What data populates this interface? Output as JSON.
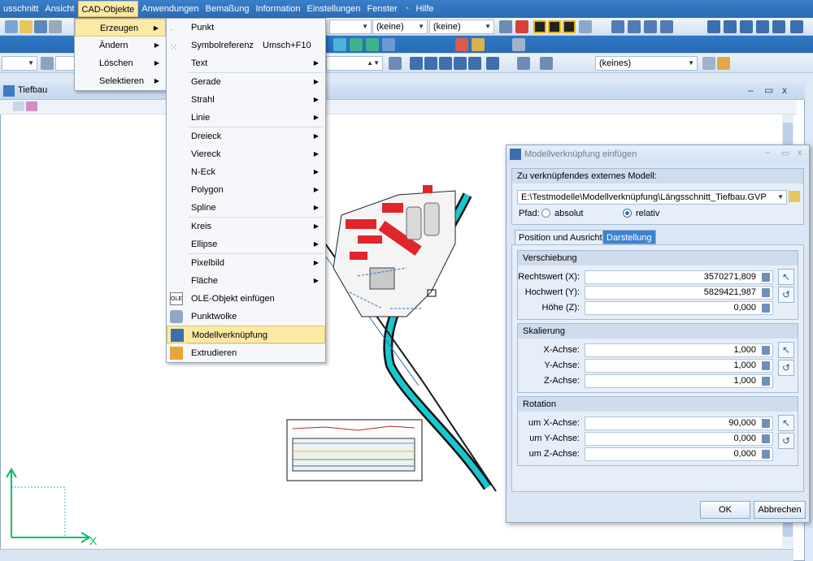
{
  "menubar": {
    "items": [
      "usschnitt",
      "Ansicht",
      "CAD-Objekte",
      "Anwendungen",
      "Bemaßung",
      "Information",
      "Einstellungen",
      "Fenster",
      "Hilfe"
    ]
  },
  "toolbar": {
    "combo1": "(keine)",
    "combo2": "(keine)",
    "combo3": "(keines)"
  },
  "cad_menu": {
    "items": [
      "Erzeugen",
      "Ändern",
      "Löschen",
      "Selektieren"
    ]
  },
  "erzeugen_menu": {
    "items": [
      {
        "label": "Punkt",
        "shortcut": "",
        "submenu": false
      },
      {
        "label": "Symbolreferenz",
        "shortcut": "Umsch+F10",
        "submenu": false
      },
      {
        "label": "Text",
        "shortcut": "",
        "submenu": true
      },
      {
        "label": "Gerade",
        "shortcut": "",
        "submenu": true
      },
      {
        "label": "Strahl",
        "shortcut": "",
        "submenu": true
      },
      {
        "label": "Linie",
        "shortcut": "",
        "submenu": true
      },
      {
        "label": "Dreieck",
        "shortcut": "",
        "submenu": true
      },
      {
        "label": "Viereck",
        "shortcut": "",
        "submenu": true
      },
      {
        "label": "N-Eck",
        "shortcut": "",
        "submenu": true
      },
      {
        "label": "Polygon",
        "shortcut": "",
        "submenu": true
      },
      {
        "label": "Spline",
        "shortcut": "",
        "submenu": true
      },
      {
        "label": "Kreis",
        "shortcut": "",
        "submenu": true
      },
      {
        "label": "Ellipse",
        "shortcut": "",
        "submenu": true
      },
      {
        "label": "Pixelbild",
        "shortcut": "",
        "submenu": true
      },
      {
        "label": "Fläche",
        "shortcut": "",
        "submenu": true
      },
      {
        "label": "OLE-Objekt einfügen",
        "shortcut": "",
        "submenu": false
      },
      {
        "label": "Punktwolke",
        "shortcut": "",
        "submenu": false
      },
      {
        "label": "Modellverknüpfung",
        "shortcut": "",
        "submenu": false
      },
      {
        "label": "Extrudieren",
        "shortcut": "",
        "submenu": false
      }
    ]
  },
  "main_window": {
    "title": "Tiefbau"
  },
  "dialog": {
    "title": "Modellverknüpfung einfügen",
    "model_group": "Zu verknüpfendes externes Modell:",
    "path_value": "E:\\Testmodelle\\Modellverknüpfung\\Längsschnitt_Tiefbau.GVP",
    "path_label": "Pfad:",
    "radio_absolute": "absolut",
    "radio_relative": "relativ",
    "tab_position": "Position und Ausrichtung",
    "tab_display": "Darstellung",
    "shift_group": "Verschiebung",
    "rechtswert_label": "Rechtswert (X):",
    "rechtswert": "3570271,809",
    "hochwert_label": "Hochwert (Y):",
    "hochwert": "5829421,987",
    "hoehe_label": "Höhe (Z):",
    "hoehe": "0,000",
    "scale_group": "Skalierung",
    "x_axis_label": "X-Achse:",
    "x_axis": "1,000",
    "y_axis_label": "Y-Achse:",
    "y_axis": "1,000",
    "z_axis_label": "Z-Achse:",
    "z_axis": "1,000",
    "rotation_group": "Rotation",
    "rot_x_label": "um X-Achse:",
    "rot_x": "90,000",
    "rot_y_label": "um Y-Achse:",
    "rot_y": "0,000",
    "rot_z_label": "um Z-Achse:",
    "rot_z": "0,000",
    "ok": "OK",
    "cancel": "Abbrechen"
  },
  "axes": {
    "x": "X"
  },
  "colors": {
    "accent": "#2a6bb5",
    "highlight": "#fbe9a6",
    "building": "#e0262a",
    "river": "#19c7cf"
  }
}
